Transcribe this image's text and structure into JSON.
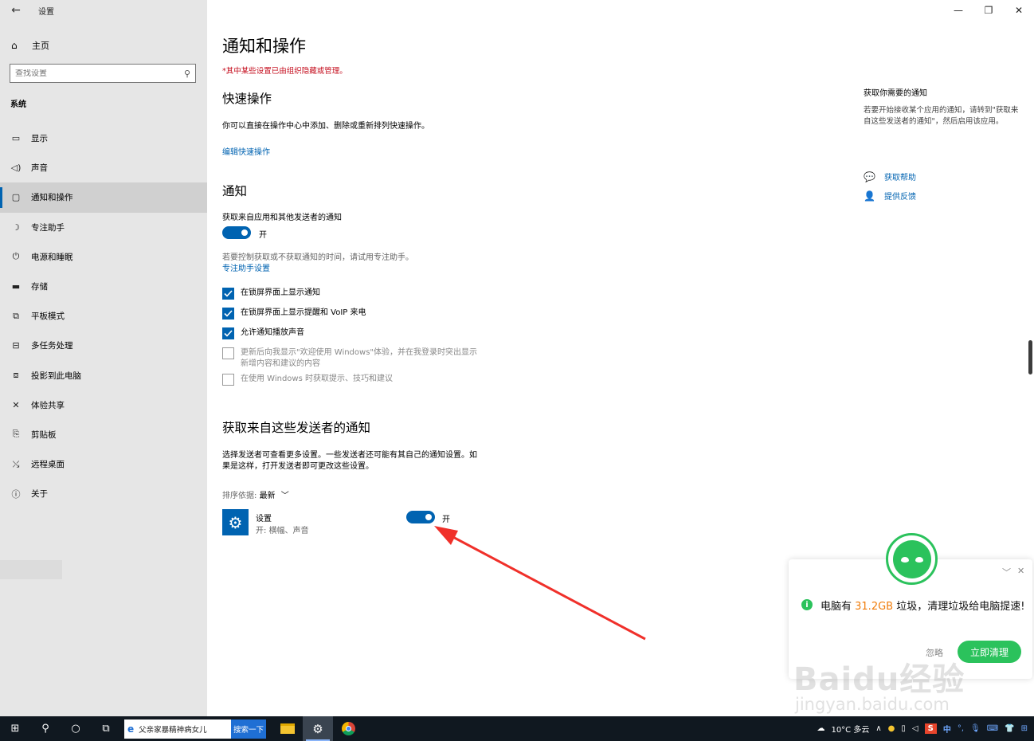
{
  "window": {
    "title": "设置",
    "controls": [
      "minimize-icon",
      "restore-icon",
      "close-icon"
    ]
  },
  "sidebar": {
    "home_label": "主页",
    "search_placeholder": "查找设置",
    "group_label": "系统",
    "items": [
      {
        "label": "显示",
        "icon": "display-icon"
      },
      {
        "label": "声音",
        "icon": "sound-icon"
      },
      {
        "label": "通知和操作",
        "icon": "notification-icon",
        "active": true
      },
      {
        "label": "专注助手",
        "icon": "focus-assist-icon"
      },
      {
        "label": "电源和睡眠",
        "icon": "power-icon"
      },
      {
        "label": "存储",
        "icon": "storage-icon"
      },
      {
        "label": "平板模式",
        "icon": "tablet-mode-icon"
      },
      {
        "label": "多任务处理",
        "icon": "multitasking-icon"
      },
      {
        "label": "投影到此电脑",
        "icon": "project-icon"
      },
      {
        "label": "体验共享",
        "icon": "shared-experiences-icon"
      },
      {
        "label": "剪贴板",
        "icon": "clipboard-icon"
      },
      {
        "label": "远程桌面",
        "icon": "remote-desktop-icon"
      },
      {
        "label": "关于",
        "icon": "about-icon"
      }
    ]
  },
  "main": {
    "title": "通知和操作",
    "managed_notice": "*其中某些设置已由组织隐藏或管理。",
    "quick_actions": {
      "heading": "快速操作",
      "description": "你可以直接在操作中心中添加、删除或重新排列快速操作。",
      "edit_link": "编辑快速操作"
    },
    "notifications": {
      "heading": "通知",
      "toggle_caption": "获取来自应用和其他发送者的通知",
      "toggle_state": "开",
      "focus_hint": "若要控制获取或不获取通知的时间，请试用专注助手。",
      "focus_link": "专注助手设置",
      "checkboxes": [
        {
          "label": "在锁屏界面上显示通知",
          "checked": true
        },
        {
          "label": "在锁屏界面上显示提醒和 VoIP 来电",
          "checked": true
        },
        {
          "label": "允许通知播放声音",
          "checked": true
        },
        {
          "label": "更新后向我显示\"欢迎使用 Windows\"体验，并在我登录时突出显示",
          "label2": "新增内容和建议的内容",
          "checked": false
        },
        {
          "label": "在使用 Windows 时获取提示、技巧和建议",
          "checked": false
        }
      ]
    },
    "senders": {
      "heading": "获取来自这些发送者的通知",
      "description1": "选择发送者可查看更多设置。一些发送者还可能有其自己的通知设置。如",
      "description2": "果是这样，打开发送者即可更改这些设置。",
      "sort_label": "排序依据:",
      "sort_value": "最新",
      "apps": [
        {
          "name": "设置",
          "detail": "开: 横幅、声音",
          "state": "开",
          "icon": "gear-icon"
        }
      ]
    }
  },
  "right_panel": {
    "title": "获取你需要的通知",
    "description": "若要开始接收某个应用的通知，请转到\"获取来自这些发送者的通知\"，然后启用该应用。",
    "help_link": "获取帮助",
    "feedback_link": "提供反馈"
  },
  "popup": {
    "message_prefix": "电脑有 ",
    "amount": "31.2GB",
    "message_suffix": " 垃圾，清理垃圾给电脑提速!",
    "ignore_label": "忽略",
    "clean_button": "立即清理",
    "accent": "#2bc25c",
    "highlight": "#f07c0a"
  },
  "watermark": {
    "line1": "Baidu经验",
    "line2": "jingyan.baidu.com"
  },
  "taskbar": {
    "search_text": "父亲家暴精神病女儿",
    "search_button": "搜索一下",
    "weather": "10°C 多云",
    "ime_label": "中",
    "apps": [
      "file-explorer-icon",
      "settings-icon",
      "chrome-icon"
    ]
  },
  "colors": {
    "accent": "#0063b1",
    "warning": "#c50f1f",
    "sidebar_bg": "#e6e6e6",
    "taskbar_bg": "#101820"
  }
}
